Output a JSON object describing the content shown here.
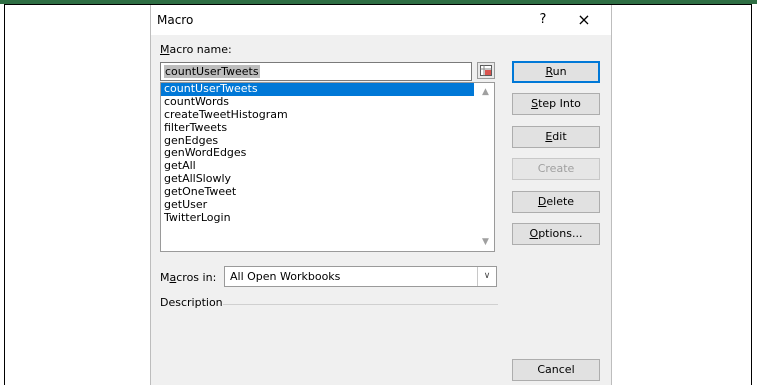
{
  "window": {
    "title": "Macro",
    "help": "?",
    "close": "×"
  },
  "macro_name": {
    "label_first": "M",
    "label_rest": "acro name:",
    "value": "countUserTweets"
  },
  "list": {
    "items": [
      "countUserTweets",
      "countWords",
      "createTweetHistogram",
      "filterTweets",
      "genEdges",
      "genWordEdges",
      "getAll",
      "getAllSlowly",
      "getOneTweet",
      "getUser",
      "TwitterLogin"
    ],
    "selected": "countUserTweets"
  },
  "buttons": {
    "run": {
      "first": "R",
      "rest": "un"
    },
    "step_into": {
      "first": "S",
      "rest": "tep Into"
    },
    "edit": {
      "first": "E",
      "rest": "dit"
    },
    "create": "Create",
    "delete": {
      "first": "D",
      "rest": "elete"
    },
    "options": {
      "first": "O",
      "rest": "ptions..."
    },
    "cancel": "Cancel"
  },
  "macros_in": {
    "label_before": "M",
    "label_underlined": "a",
    "label_after": "cros in:",
    "value": "All Open Workbooks"
  },
  "description_label": "Description",
  "colors": {
    "accent": "#0078d7",
    "top_strip": "#2e6e43"
  }
}
